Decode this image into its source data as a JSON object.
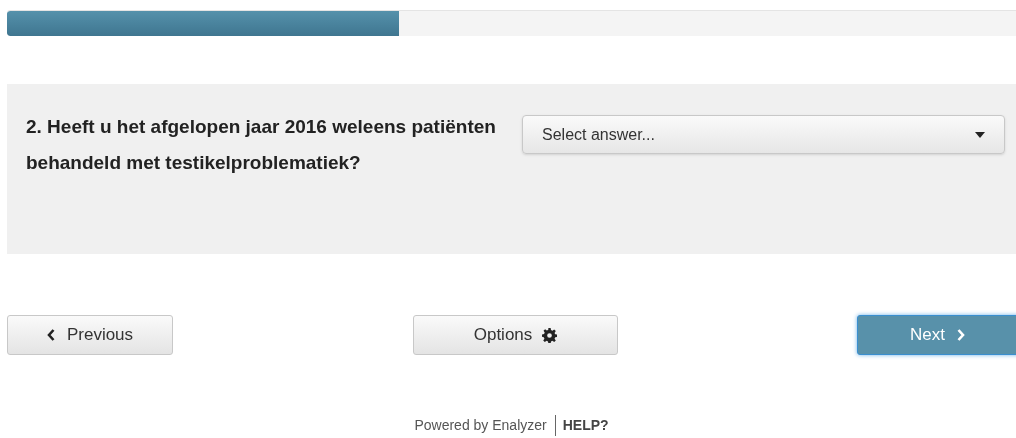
{
  "progress": {
    "level": 0.383
  },
  "question": {
    "number": "2.",
    "text": "Heeft u het afgelopen jaar 2016 weleens patiënten behandeld met testikelproblematiek?",
    "dropdown": {
      "placeholder": "Select answer..."
    }
  },
  "nav": {
    "previous": "Previous",
    "options": "Options",
    "next": "Next"
  },
  "footer": {
    "powered": "Powered by Enalyzer",
    "help": "HELP?"
  }
}
